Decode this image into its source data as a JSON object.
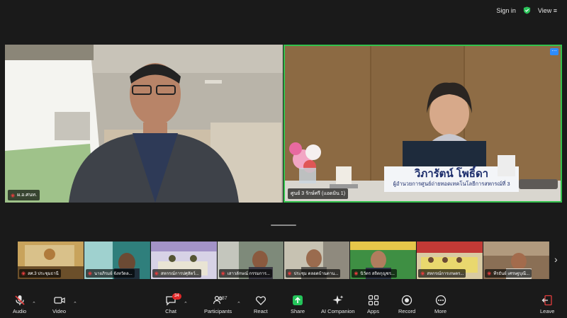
{
  "top": {
    "sign_in": "Sign in",
    "view": "View"
  },
  "main_tiles": [
    {
      "name": "ผ.อ.ศนท."
    },
    {
      "name": "ศูนย์ 3 รักษ์ศรี (แอดมิน 1)",
      "person_name": "วิภารัตน์  โพธิ์ดา",
      "person_title": "ผู้อำนวยการศูนย์ถ่ายทอดเทคโนโลยีการสหกรณ์ที่ 3"
    }
  ],
  "thumbnails": [
    {
      "name": "สศ.3 ประชุมธานี"
    },
    {
      "name": "นายภิรมย์ จังหวัดล..."
    },
    {
      "name": "สหกรณ์การปศุสัตว์..."
    },
    {
      "name": "เสาวลักษณ์ กรรมการ..."
    },
    {
      "name": "ประชุม ตลอดบ้านตาน..."
    },
    {
      "name": "นิวัตร สถิตกุญชร..."
    },
    {
      "name": "สหกรณ์การเกษตร..."
    },
    {
      "name": "ทีรธันย์ เศรษฐบุณี..."
    }
  ],
  "toolbar": {
    "audio": "Audio",
    "video": "Video",
    "chat": "Chat",
    "chat_badge": "34",
    "participants": "Participants",
    "participants_count": "187",
    "react": "React",
    "share": "Share",
    "ai": "AI Companion",
    "apps": "Apps",
    "record": "Record",
    "more": "More",
    "leave": "Leave"
  },
  "colors": {
    "active_speaker": "#33c24d",
    "share_green": "#24c45a",
    "alert_red": "#e23d3d",
    "accent_blue": "#2d8cff"
  }
}
